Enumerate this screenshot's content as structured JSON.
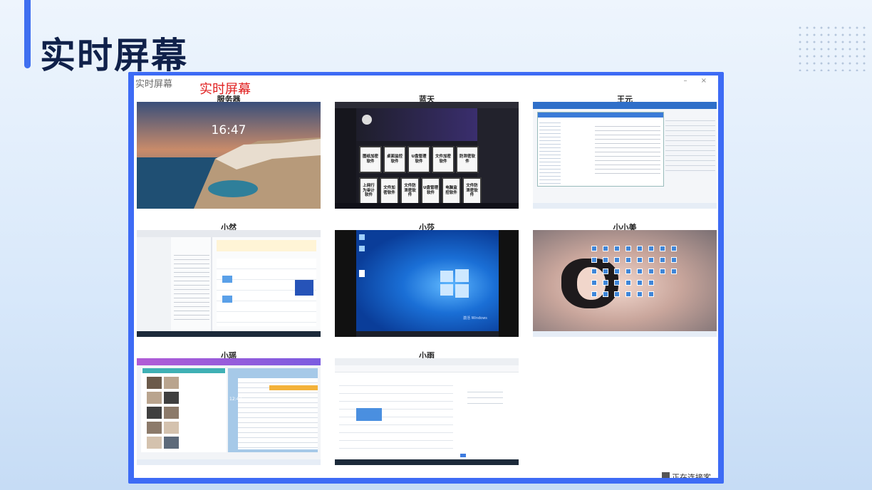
{
  "slide": {
    "title": "实时屏幕"
  },
  "window": {
    "app_title": "实时屏幕",
    "overlay_heading": "实时屏幕",
    "controls": "– ×"
  },
  "screens": [
    {
      "label": "服务器",
      "clock": "16:47"
    },
    {
      "label": "蓝天",
      "tiles": [
        "图纸加密软件",
        "桌面监控软件",
        "U盘管理软件",
        "文件加密软件",
        "防泄密软件",
        "上网行为审计软件",
        "文件加密软件",
        "文件防泄密软件",
        "U盘管理软件",
        "电脑监控软件",
        "文件防泄密软件"
      ]
    },
    {
      "label": "王元"
    },
    {
      "label": "小然"
    },
    {
      "label": "小莎",
      "watermark": "激活 Windows"
    },
    {
      "label": "小小美"
    },
    {
      "label": "小瑶"
    },
    {
      "label": "小雨"
    }
  ],
  "status": {
    "text": "正在连接客户端"
  },
  "colors": {
    "accent": "#3d6bf5",
    "title": "#10214a",
    "heading_red": "#e02020"
  }
}
